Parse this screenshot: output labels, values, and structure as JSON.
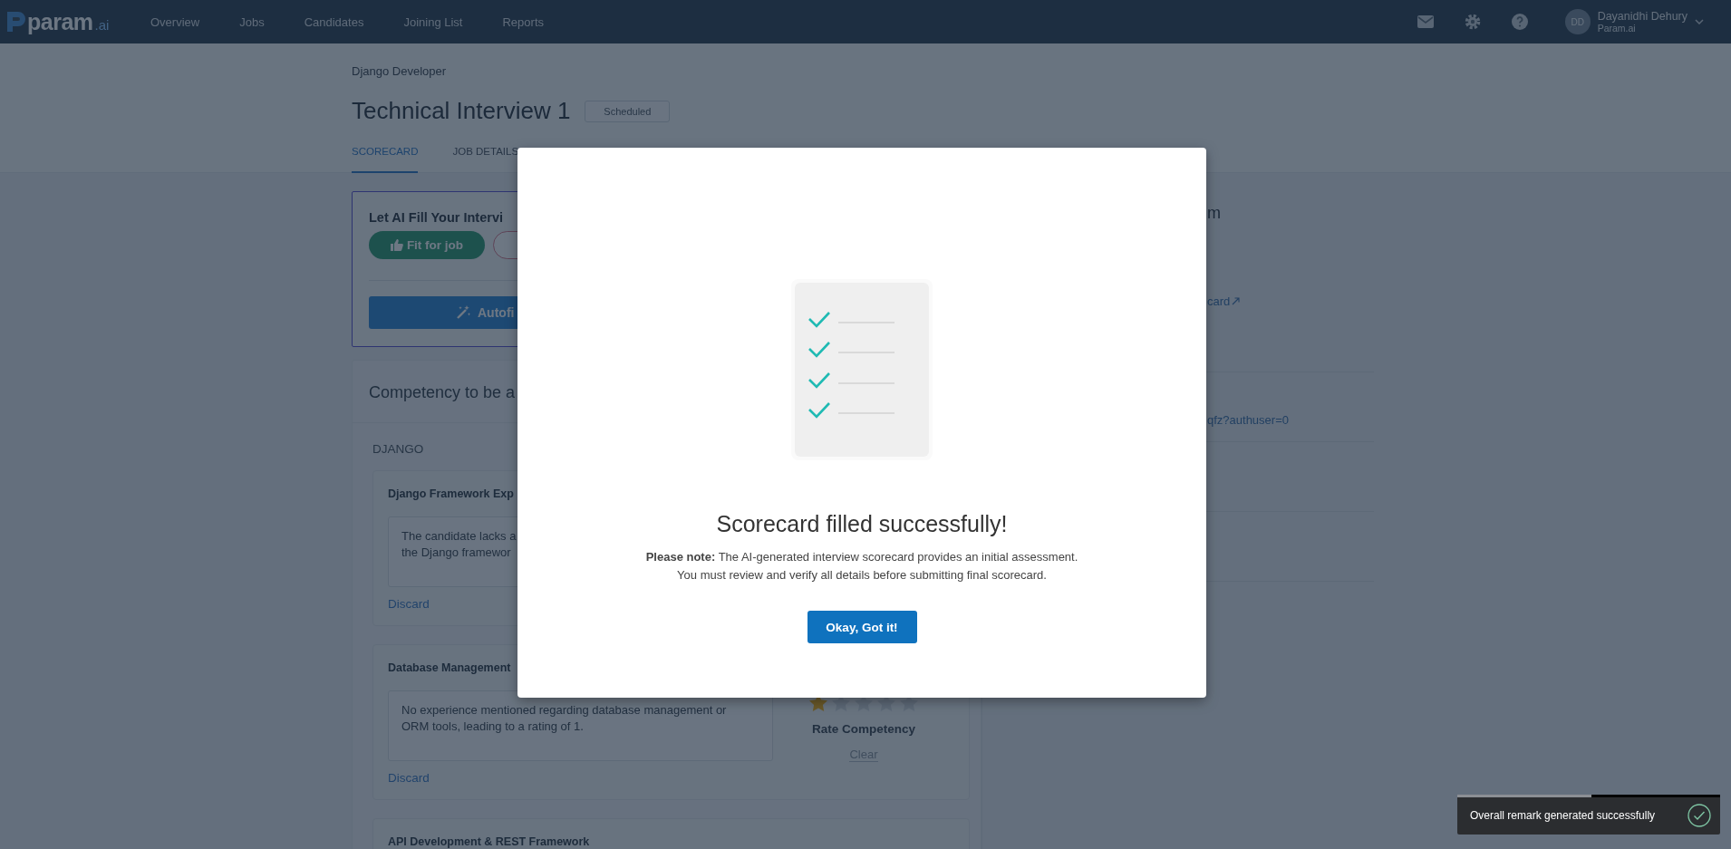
{
  "top_nav": {
    "logo": {
      "name": "param",
      "suffix": ".ai"
    },
    "items": [
      {
        "label": "Overview"
      },
      {
        "label": "Jobs"
      },
      {
        "label": "Candidates"
      },
      {
        "label": "Joining List"
      },
      {
        "label": "Reports"
      }
    ],
    "user": {
      "initials": "DD",
      "name": "Dayanidhi Dehury",
      "org": "Param.ai"
    }
  },
  "header": {
    "breadcrumb": "Django Developer",
    "title": "Technical Interview 1",
    "status": "Scheduled",
    "tabs": [
      {
        "label": "SCORECARD",
        "selected": true
      },
      {
        "label": "JOB DETAILS",
        "selected": false
      }
    ]
  },
  "ai_fill_card": {
    "title": "Let AI Fill Your Intervi",
    "fit_button": "Fit for job",
    "autofill_button": "Autofi"
  },
  "competency_panel": {
    "title": "Competency to be a",
    "group": "DJANGO",
    "items": [
      {
        "title": "Django Framework Exp",
        "remark_lines": [
          "The candidate lacks a",
          "the Django framewor"
        ],
        "discard": "Discard"
      },
      {
        "title": "Database Management",
        "remark_lines": [
          "No experience mentioned regarding database management or",
          "ORM tools, leading to a rating of 1."
        ],
        "stars": 1,
        "rating_label": "Rate Competency",
        "clear": "Clear",
        "discard": "Discard"
      },
      {
        "title": "API Development & REST Framework"
      }
    ]
  },
  "side_panel": {
    "heading": "m",
    "scorecard_link": "card",
    "meet_link": "qfz?authuser=0"
  },
  "modal": {
    "title": "Scorecard filled successfully!",
    "note_lines": [
      "**Please note:** The AI-generated interview scorecard provides an initial assessment.",
      "You must review and verify all details before submitting final scorecard."
    ],
    "button": "Okay, Got it!"
  },
  "toast": {
    "message": "Overall remark generated successfully",
    "level": 0.51
  }
}
